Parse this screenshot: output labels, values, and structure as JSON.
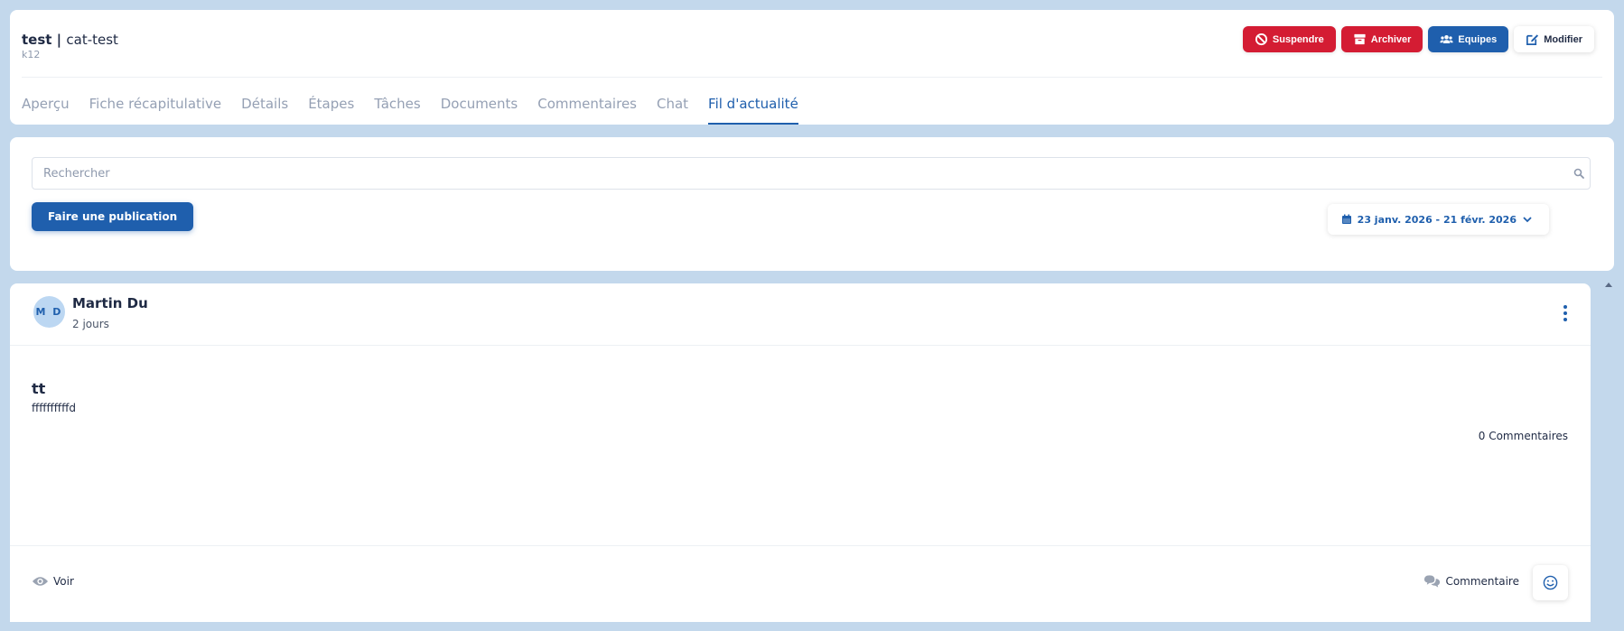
{
  "header": {
    "title_bold": "test",
    "title_separator": " | ",
    "title_rest": "cat-test",
    "subtitle": "k12",
    "actions": {
      "suspend_label": "Suspendre",
      "archive_label": "Archiver",
      "teams_label": "Equipes",
      "edit_label": "Modifier"
    },
    "tabs": [
      {
        "label": "Aperçu"
      },
      {
        "label": "Fiche récapitulative"
      },
      {
        "label": "Détails"
      },
      {
        "label": "Étapes"
      },
      {
        "label": "Tâches"
      },
      {
        "label": "Documents"
      },
      {
        "label": "Commentaires"
      },
      {
        "label": "Chat"
      },
      {
        "label": "Fil d'actualité"
      }
    ],
    "active_tab": "Fil d'actualité"
  },
  "feed": {
    "search_placeholder": "Rechercher",
    "search_value": "",
    "publish_label": "Faire une publication",
    "date_range": "23 janv. 2026 - 21 févr. 2026"
  },
  "post": {
    "author_initials": "M D",
    "author_name": "Martin Du",
    "time_ago": "2 jours",
    "title": "tt",
    "body": "ffffffffffd",
    "comments_count": "0 Commentaires",
    "view_label": "Voir",
    "comment_label": "Commentaire"
  },
  "colors": {
    "background": "#c3d8ec",
    "primary": "#1f5fad",
    "danger": "#d41c33",
    "muted_text": "#95a0b4"
  }
}
